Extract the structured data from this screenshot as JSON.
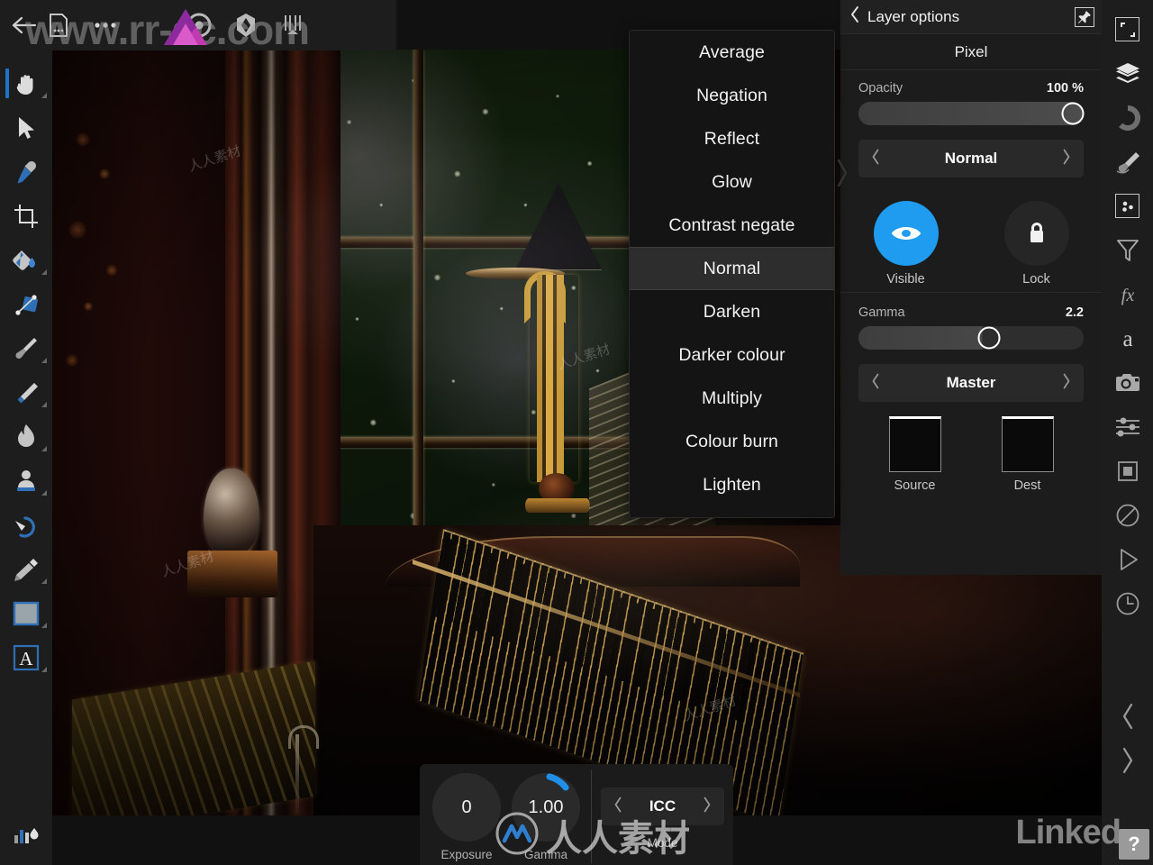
{
  "app": {
    "topbar": {
      "back_label": "back-arrow",
      "icons": [
        "document-icon",
        "more-options-icon",
        "affinity-logo-icon",
        "develop-persona-icon",
        "photo-persona-icon",
        "liquify-persona-icon",
        "export-persona-icon"
      ]
    },
    "left_toolbar": {
      "tools": [
        {
          "name": "hand-tool",
          "active": true,
          "has_flyout": true
        },
        {
          "name": "move-tool",
          "active": false,
          "has_flyout": false
        },
        {
          "name": "colour-picker-tool",
          "active": false,
          "has_flyout": false
        },
        {
          "name": "crop-tool",
          "active": false,
          "has_flyout": false
        },
        {
          "name": "flood-fill-tool",
          "active": false,
          "has_flyout": true
        },
        {
          "name": "gradient-tool",
          "active": false,
          "has_flyout": false
        },
        {
          "name": "paint-brush-tool",
          "active": false,
          "has_flyout": true
        },
        {
          "name": "erase-brush-tool",
          "active": false,
          "has_flyout": true
        },
        {
          "name": "dodge-burn-tool",
          "active": false,
          "has_flyout": true
        },
        {
          "name": "clone-brush-tool",
          "active": false,
          "has_flyout": true
        },
        {
          "name": "smudge-tool",
          "active": false,
          "has_flyout": true
        },
        {
          "name": "pen-tool",
          "active": false,
          "has_flyout": true
        },
        {
          "name": "rectangle-shape-tool",
          "active": false,
          "has_flyout": true
        },
        {
          "name": "artistic-text-tool",
          "active": false,
          "has_flyout": true
        }
      ],
      "bottom_icon": "levels-icon"
    },
    "blend_menu": {
      "items": [
        {
          "label": "Average",
          "selected": false
        },
        {
          "label": "Negation",
          "selected": false
        },
        {
          "label": "Reflect",
          "selected": false
        },
        {
          "label": "Glow",
          "selected": false
        },
        {
          "label": "Contrast negate",
          "selected": false
        },
        {
          "label": "Normal",
          "selected": true
        },
        {
          "label": "Darken",
          "selected": false
        },
        {
          "label": "Darker colour",
          "selected": false
        },
        {
          "label": "Multiply",
          "selected": false
        },
        {
          "label": "Colour burn",
          "selected": false
        },
        {
          "label": "Lighten",
          "selected": false
        }
      ]
    },
    "panel": {
      "title": "Layer options",
      "back_icon": "chevron-left-icon",
      "pin_icon": "pin-icon",
      "subtitle": "Pixel",
      "opacity": {
        "label": "Opacity",
        "value": "100 %",
        "knob_pct": 95
      },
      "blend_mode": {
        "value": "Normal",
        "prev_icon": "chevron-left-icon",
        "next_icon": "chevron-right-icon"
      },
      "toggles": [
        {
          "label": "Visible",
          "icon": "eye-icon",
          "state": "on"
        },
        {
          "label": "Lock",
          "icon": "lock-icon",
          "state": "off"
        }
      ],
      "gamma": {
        "label": "Gamma",
        "value": "2.2",
        "knob_pct": 58
      },
      "channel": {
        "value": "Master",
        "prev_icon": "chevron-left-icon",
        "next_icon": "chevron-right-icon"
      },
      "swatches": [
        {
          "label": "Source",
          "name": "source-swatch"
        },
        {
          "label": "Dest",
          "name": "dest-swatch"
        }
      ]
    },
    "right_toolbar": {
      "icons": [
        "transform-studio-icon",
        "layers-studio-icon",
        "colour-wheel-studio-icon",
        "brushes-studio-icon",
        "swatches-studio-icon",
        "adjustment-filter-icon",
        "effects-fx-icon",
        "character-studio-icon",
        "stock-camera-icon",
        "adjustments-sliders-icon",
        "channels-icon",
        "no-selection-icon",
        "macro-play-icon",
        "history-clock-icon"
      ],
      "nav": [
        "chevron-left-icon",
        "chevron-right-icon"
      ],
      "help_label": "?"
    },
    "bottom_bar": {
      "dials": [
        {
          "label": "Exposure",
          "value": "0",
          "arc": false
        },
        {
          "label": "Gamma",
          "value": "1.00",
          "arc": true
        }
      ],
      "mode": {
        "label": "Mode",
        "value": "ICC",
        "prev_icon": "chevron-left-icon",
        "next_icon": "chevron-right-icon"
      }
    },
    "watermarks": {
      "top": "www.rr-sc.com",
      "center_cn": "人人素材",
      "bottom_right": "Linked",
      "tile": "人人素材"
    },
    "colors": {
      "accent_blue": "#1f9bf0",
      "tool_active": "#1f72c8",
      "panel_bg": "#1c1c1c",
      "toolbar_bg": "#1d1d1d",
      "menu_bg": "#141414",
      "menu_selected": "#2d2d2d",
      "affinity_magenta": "#d946c8"
    }
  }
}
